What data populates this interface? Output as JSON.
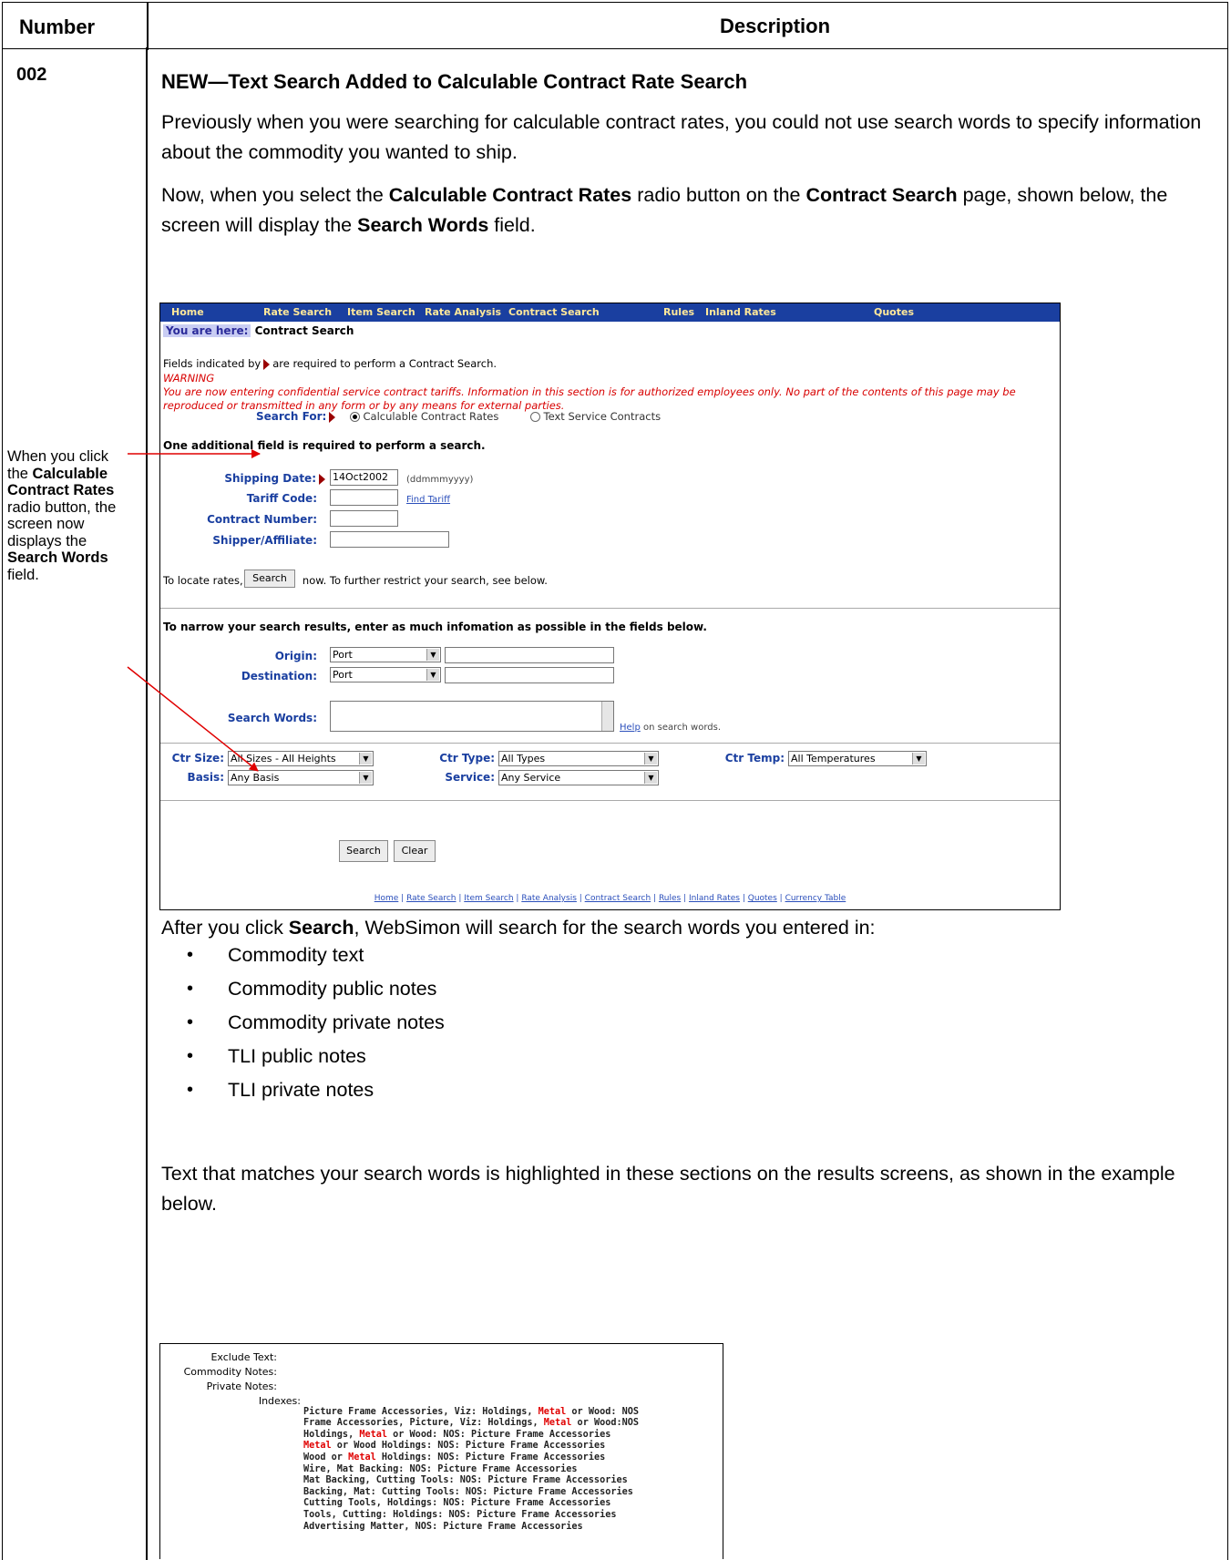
{
  "header": {
    "number": "Number",
    "description": "Description"
  },
  "row": {
    "number": "002",
    "title": "NEW—Text Search Added to Calculable Contract Rate Search",
    "para1": "Previously when you were searching for calculable contract rates, you could not use search words to specify information about the commodity you wanted to ship.",
    "para2_parts": [
      "Now, when you select the ",
      "Calculable Contract Rates",
      " radio button on the ",
      "Contract Search",
      " page, shown below, the screen will display the ",
      "Search Words",
      " field."
    ],
    "side_note_parts": [
      "When you click the ",
      "Calculable Contract Rates",
      " radio button, the screen now displays the ",
      "Search Words",
      " field."
    ],
    "para3_parts": [
      "After you click ",
      "Search",
      ", WebSimon will search for the search words you entered in:"
    ],
    "bullets": [
      "Commodity text",
      "Commodity public notes",
      "Commodity private notes",
      "TLI public notes",
      "TLI private notes"
    ],
    "para4": "Text that matches your search words is highlighted in these sections on the results screens, as shown in the example below."
  },
  "screenshot": {
    "nav": [
      "Home",
      "Rate Search",
      "Item Search",
      "Rate Analysis",
      "Contract Search",
      "Rules",
      "Inland Rates",
      "Quotes"
    ],
    "you_are_here_label": "You are here:",
    "you_are_here_value": "Contract Search",
    "required_note_before": "Fields indicated by",
    "required_note_after": "are required to perform a Contract Search.",
    "warning_title": "WARNING",
    "warning_text": "You are now entering confidential service contract tariffs. Information in this section is for authorized employees only. No part of the contents of this page may be reproduced or transmitted in any form or by any means for external parties.",
    "search_for_label": "Search For:",
    "radio_options": [
      "Calculable Contract Rates",
      "Text Service Contracts"
    ],
    "additional_required": "One additional field is required to perform a search.",
    "shipping_date_label": "Shipping Date:",
    "shipping_date_value": "14Oct2002",
    "date_format": "(ddmmmyyyy)",
    "tariff_code_label": "Tariff Code:",
    "find_tariff": "Find Tariff",
    "contract_number_label": "Contract Number:",
    "shipper_label": "Shipper/Affiliate:",
    "locate_before": "To locate rates,",
    "search_button": "Search",
    "locate_after": "now. To further restrict your search, see below.",
    "narrow_text": "To narrow your search results, enter as much infomation as possible in the fields below.",
    "origin_label": "Origin:",
    "origin_value": "Port",
    "destination_label": "Destination:",
    "destination_value": "Port",
    "search_words_label": "Search Words:",
    "help_link": "Help",
    "help_after": "on search words.",
    "ctr_size_label": "Ctr Size:",
    "ctr_size_value": "All Sizes - All Heights",
    "basis_label": "Basis:",
    "basis_value": "Any Basis",
    "ctr_type_label": "Ctr Type:",
    "ctr_type_value": "All Types",
    "service_label": "Service:",
    "service_value": "Any Service",
    "ctr_temp_label": "Ctr Temp:",
    "ctr_temp_value": "All Temperatures",
    "clear_button": "Clear",
    "footer_links": [
      "Home",
      "Rate Search",
      "Item Search",
      "Rate Analysis",
      "Contract Search",
      "Rules",
      "Inland Rates",
      "Quotes",
      "Currency Table"
    ]
  },
  "example": {
    "labels": [
      "Exclude Text:",
      "Commodity Notes:",
      "Private Notes:",
      "Indexes:"
    ],
    "index_lines": [
      [
        "Picture Frame Accessories, Viz: Holdings, ",
        "Metal",
        " or Wood: NOS"
      ],
      [
        "Frame Accessories, Picture, Viz: Holdings, ",
        "Metal",
        " or Wood:NOS"
      ],
      [
        "Holdings, ",
        "Metal",
        " or Wood: NOS: Picture Frame Accessories"
      ],
      [
        "",
        "Metal",
        " or Wood Holdings: NOS: Picture Frame Accessories"
      ],
      [
        "Wood or ",
        "Metal",
        " Holdings: NOS: Picture Frame Accessories"
      ],
      [
        "Wire, Mat Backing: NOS: Picture Frame Accessories",
        "",
        ""
      ],
      [
        "Mat Backing, Cutting Tools: NOS: Picture Frame Accessories",
        "",
        ""
      ],
      [
        "Backing, Mat: Cutting Tools: NOS: Picture Frame Accessories",
        "",
        ""
      ],
      [
        "Cutting Tools, Holdings: NOS: Picture Frame Accessories",
        "",
        ""
      ],
      [
        "Tools, Cutting: Holdings: NOS: Picture Frame Accessories",
        "",
        ""
      ],
      [
        "Advertising Matter, NOS: Picture Frame Accessories",
        "",
        ""
      ]
    ]
  },
  "colors": {
    "nav_bg": "#1a3fa0",
    "nav_text": "#ffe89a",
    "warning": "#d80000",
    "highlight": "#e00000",
    "arrow": "#e00000"
  }
}
